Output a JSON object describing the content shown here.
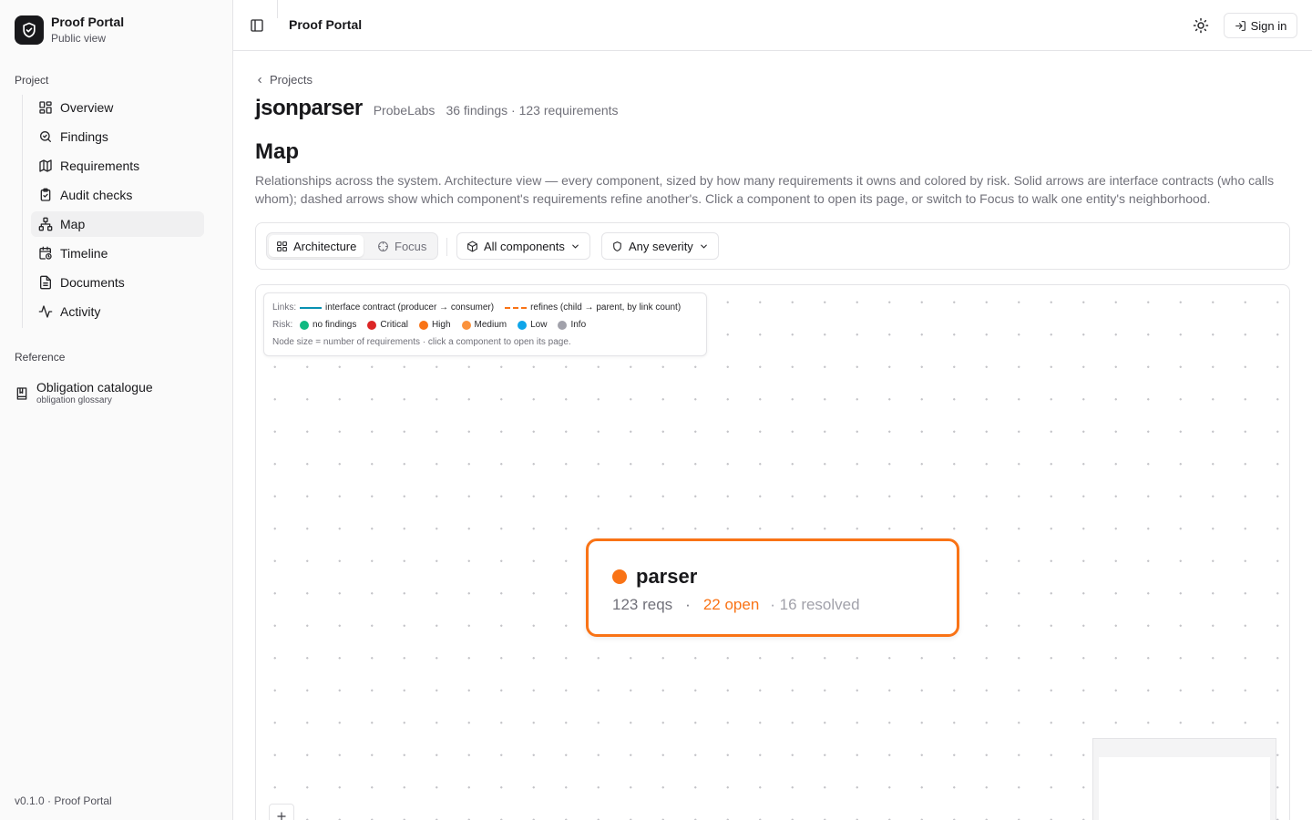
{
  "brand": {
    "title": "Proof Portal",
    "subtitle": "Public view"
  },
  "sidebar": {
    "project_label": "Project",
    "items": [
      {
        "label": "Overview",
        "icon": "grid-icon"
      },
      {
        "label": "Findings",
        "icon": "search-icon"
      },
      {
        "label": "Requirements",
        "icon": "map-icon"
      },
      {
        "label": "Audit checks",
        "icon": "clipboard-check-icon"
      },
      {
        "label": "Map",
        "icon": "network-icon",
        "active": true
      },
      {
        "label": "Timeline",
        "icon": "calendar-clock-icon"
      },
      {
        "label": "Documents",
        "icon": "file-text-icon"
      },
      {
        "label": "Activity",
        "icon": "activity-icon"
      }
    ],
    "reference_label": "Reference",
    "reference_item": {
      "title": "Obligation catalogue",
      "subtitle": "obligation glossary",
      "icon": "book-icon"
    },
    "footer": "v0.1.0 · Proof Portal"
  },
  "header": {
    "title": "Proof Portal",
    "sign_in": "Sign in"
  },
  "breadcrumb": {
    "label": "Projects"
  },
  "project": {
    "name": "jsonparser",
    "org": "ProbeLabs",
    "meta": "36 findings · 123 requirements"
  },
  "page": {
    "title": "Map",
    "description": "Relationships across the system. Architecture view — every component, sized by how many requirements it owns and colored by risk. Solid arrows are interface contracts (who calls whom); dashed arrows show which component's requirements refine another's. Click a component to open its page, or switch to Focus to walk one entity's neighborhood."
  },
  "toolbar": {
    "view_architecture": "Architecture",
    "view_focus": "Focus",
    "components_filter": "All components",
    "severity_filter": "Any severity"
  },
  "legend": {
    "links_label": "Links:",
    "link_solid": "interface contract (producer → consumer)",
    "link_dashed": "refines (child → parent, by link count)",
    "risk_label": "Risk:",
    "risks": [
      {
        "label": "no findings",
        "color": "#10b981"
      },
      {
        "label": "Critical",
        "color": "#dc2626"
      },
      {
        "label": "High",
        "color": "#f97316"
      },
      {
        "label": "Medium",
        "color": "#fb923c"
      },
      {
        "label": "Low",
        "color": "#0ea5e9"
      },
      {
        "label": "Info",
        "color": "#a1a1aa"
      }
    ],
    "note": "Node size = number of requirements · click a component to open its page."
  },
  "node": {
    "name": "parser",
    "reqs": "123 reqs",
    "sep": "·",
    "open": "22 open",
    "resolved": "· 16 resolved",
    "risk_color": "#f97316"
  },
  "colors": {
    "accent": "#f97316",
    "link_solid": "#0891b2",
    "link_dashed": "#f97316"
  }
}
